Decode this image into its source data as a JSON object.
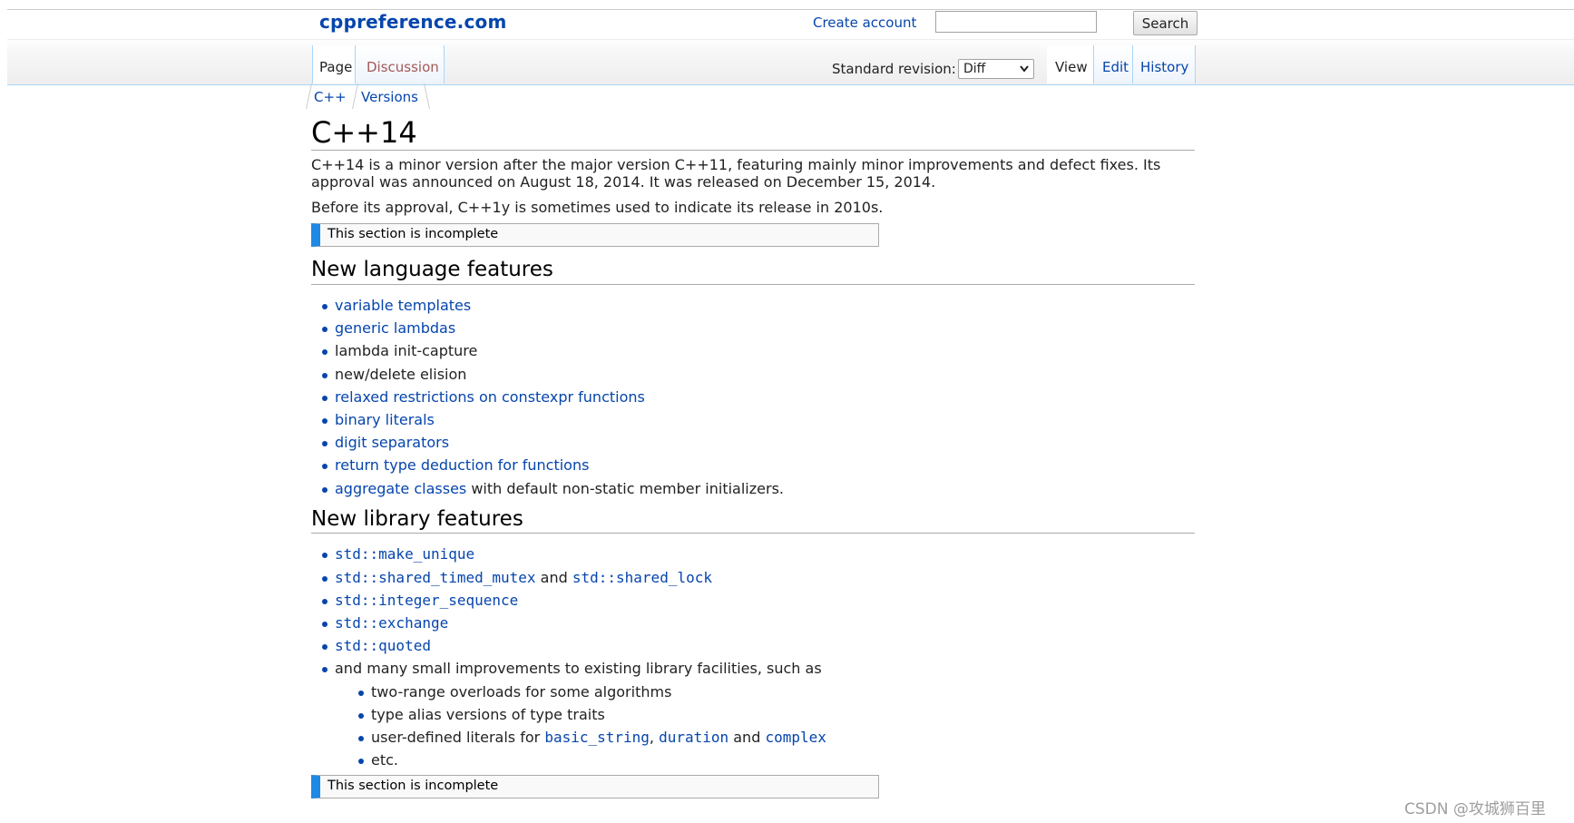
{
  "header": {
    "site_title": "cppreference.com",
    "create_account": "Create account",
    "search_placeholder": "",
    "search_button": "Search"
  },
  "tabs": {
    "page": "Page",
    "discussion": "Discussion",
    "view": "View",
    "edit": "Edit",
    "history": "History"
  },
  "standard_revision": {
    "label": "Standard revision:",
    "selected": "Diff"
  },
  "breadcrumbs": [
    "C++",
    "Versions"
  ],
  "content": {
    "title": "C++14",
    "intro": "C++14 is a minor version after the major version C++11, featuring mainly minor improvements and defect fixes. Its approval was announced on August 18, 2014. It was released on December 15, 2014.",
    "intro2": "Before its approval, C++1y is sometimes used to indicate its release in 2010s.",
    "incomplete_notice": "This section is incomplete",
    "language_heading": "New language features",
    "language_features": [
      "variable templates",
      "generic lambdas",
      "lambda init-capture",
      "new/delete elision",
      "relaxed restrictions on constexpr functions",
      "binary literals",
      "digit separators",
      "return type deduction for functions",
      "aggregate classes",
      "with default non-static member initializers."
    ],
    "library_heading": "New library features",
    "library_features": [
      "std::make_unique",
      "std::shared_timed_mutex",
      "and",
      "std::shared_lock",
      "std::integer_sequence",
      "std::exchange",
      "std::quoted",
      "and many small improvements to existing library facilities, such as"
    ],
    "library_sub": [
      "two-range overloads for some algorithms",
      "type alias versions of type traits",
      "user-defined literals for",
      "basic_string",
      ",",
      "duration",
      "and",
      "complex",
      "etc."
    ],
    "incomplete_notice2": "This section is incomplete"
  },
  "watermark": "CSDN @攻城狮百里",
  "colors": {
    "link": "#0645ad",
    "discussion_tab": "#a55858",
    "notice_bar": "#1e88e5",
    "tab_border": "#a7d7f9"
  }
}
